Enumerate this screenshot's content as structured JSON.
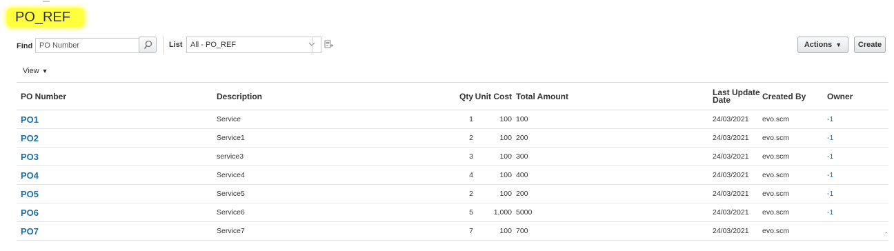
{
  "page": {
    "title": "PO_REF",
    "highlight_color": "#ffff40"
  },
  "search": {
    "find_label": "Find",
    "placeholder": "PO Number",
    "list_label": "List",
    "list_value": "All - PO_REF"
  },
  "actions": {
    "actions_label": "Actions",
    "create_label": "Create"
  },
  "view": {
    "label": "View"
  },
  "table": {
    "columns": [
      "PO Number",
      "Description",
      "Qty",
      "Unit Cost",
      "Total Amount",
      "Last Update Date",
      "Created By",
      "Owner"
    ],
    "rows": [
      {
        "po": "PO1",
        "desc": "Service",
        "qty": "1",
        "cost": "100",
        "total": "100",
        "date": "24/03/2021",
        "by": "evo.scm",
        "owner": "-1"
      },
      {
        "po": "PO2",
        "desc": "Service1",
        "qty": "2",
        "cost": "100",
        "total": "200",
        "date": "24/03/2021",
        "by": "evo.scm",
        "owner": "-1"
      },
      {
        "po": "PO3",
        "desc": "service3",
        "qty": "3",
        "cost": "100",
        "total": "300",
        "date": "24/03/2021",
        "by": "evo.scm",
        "owner": "-1"
      },
      {
        "po": "PO4",
        "desc": "Service4",
        "qty": "4",
        "cost": "100",
        "total": "400",
        "date": "24/03/2021",
        "by": "evo.scm",
        "owner": "-1"
      },
      {
        "po": "PO5",
        "desc": "Service5",
        "qty": "2",
        "cost": "100",
        "total": "200",
        "date": "24/03/2021",
        "by": "evo.scm",
        "owner": "-1"
      },
      {
        "po": "PO6",
        "desc": "Service6",
        "qty": "5",
        "cost": "1,000",
        "total": "5000",
        "date": "24/03/2021",
        "by": "evo.scm",
        "owner": "-1"
      },
      {
        "po": "PO7",
        "desc": "Service7",
        "qty": "7",
        "cost": "100",
        "total": "700",
        "date": "24/03/2021",
        "by": "evo.scm",
        "owner": "",
        "trail": "."
      }
    ]
  },
  "colors": {
    "link": "#1b6ea7"
  },
  "icons": {
    "search": "search-icon",
    "select": "chevron-down-icon",
    "export": "export-icon",
    "actions": "caret-down-icon"
  }
}
